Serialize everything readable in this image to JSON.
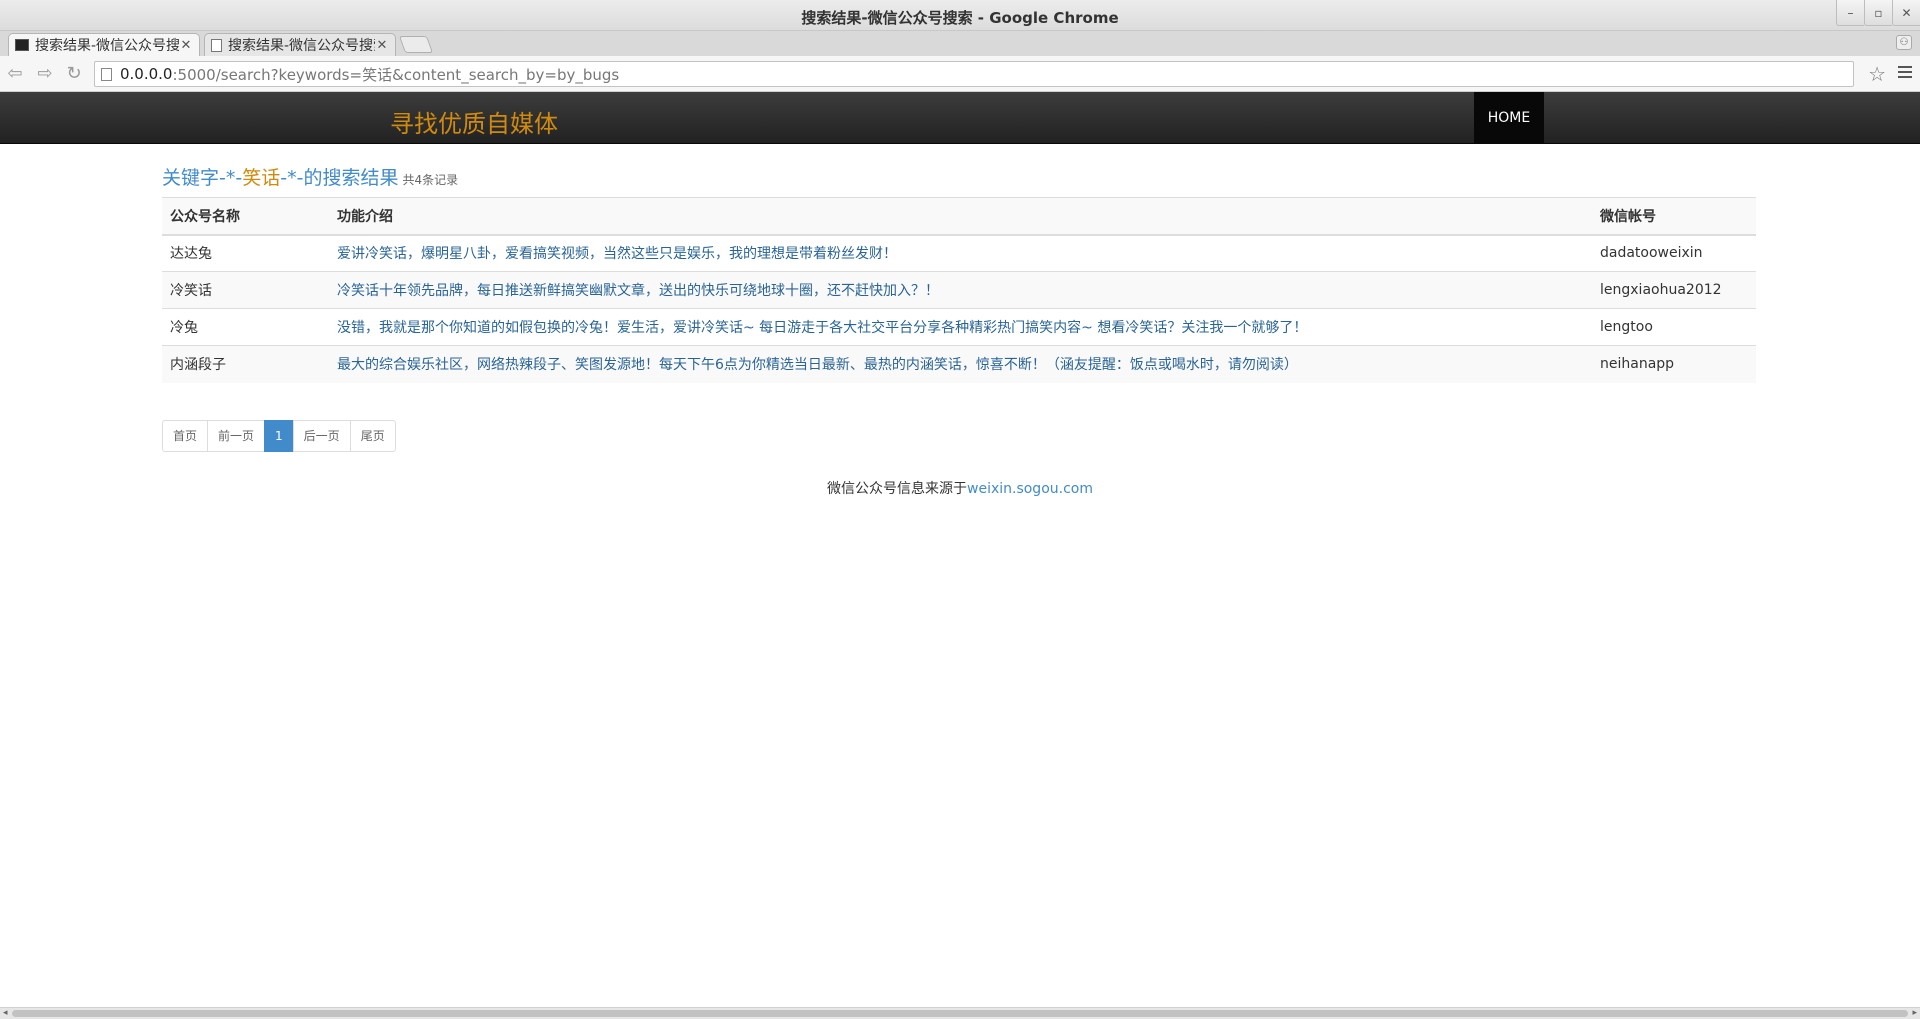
{
  "window": {
    "title": "搜索结果-微信公众号搜索 - Google Chrome"
  },
  "tabs": [
    {
      "label": "搜索结果-微信公众号搜索"
    },
    {
      "label": "搜索结果-微信公众号搜索"
    }
  ],
  "address": {
    "host": "0.0.0.0",
    "rest": ":5000/search?keywords=笑话&content_search_by=by_bugs"
  },
  "nav": {
    "brand": "寻找优质自媒体",
    "home": "HOME"
  },
  "results": {
    "prefix": "关键字-*-",
    "keyword": "笑话",
    "suffix": "-*-的搜索结果",
    "count": "共4条记录",
    "headers": {
      "name": "公众号名称",
      "desc": "功能介绍",
      "account": "微信帐号"
    },
    "rows": [
      {
        "name": "达达兔",
        "desc": "爱讲冷笑话，爆明星八卦，爱看搞笑视频，当然这些只是娱乐，我的理想是带着粉丝发财！",
        "account": "dadatooweixin"
      },
      {
        "name": "冷笑话",
        "desc": "冷笑话十年领先品牌，每日推送新鲜搞笑幽默文章，送出的快乐可绕地球十圈，还不赶快加入？！",
        "account": "lengxiaohua2012"
      },
      {
        "name": "冷兔",
        "desc": "没错，我就是那个你知道的如假包换的冷兔！爱生活，爱讲冷笑话~ 每日游走于各大社交平台分享各种精彩热门搞笑内容~ 想看冷笑话？关注我一个就够了！",
        "account": "lengtoo"
      },
      {
        "name": "内涵段子",
        "desc": "最大的综合娱乐社区，网络热辣段子、笑图发源地！每天下午6点为你精选当日最新、最热的内涵笑话，惊喜不断！（涵友提醒：饭点或喝水时，请勿阅读）",
        "account": "neihanapp"
      }
    ]
  },
  "pager": {
    "first": "首页",
    "prev": "前一页",
    "current": "1",
    "next": "后一页",
    "last": "尾页"
  },
  "footer": {
    "text": "微信公众号信息来源于",
    "link": "weixin.sogou.com"
  }
}
